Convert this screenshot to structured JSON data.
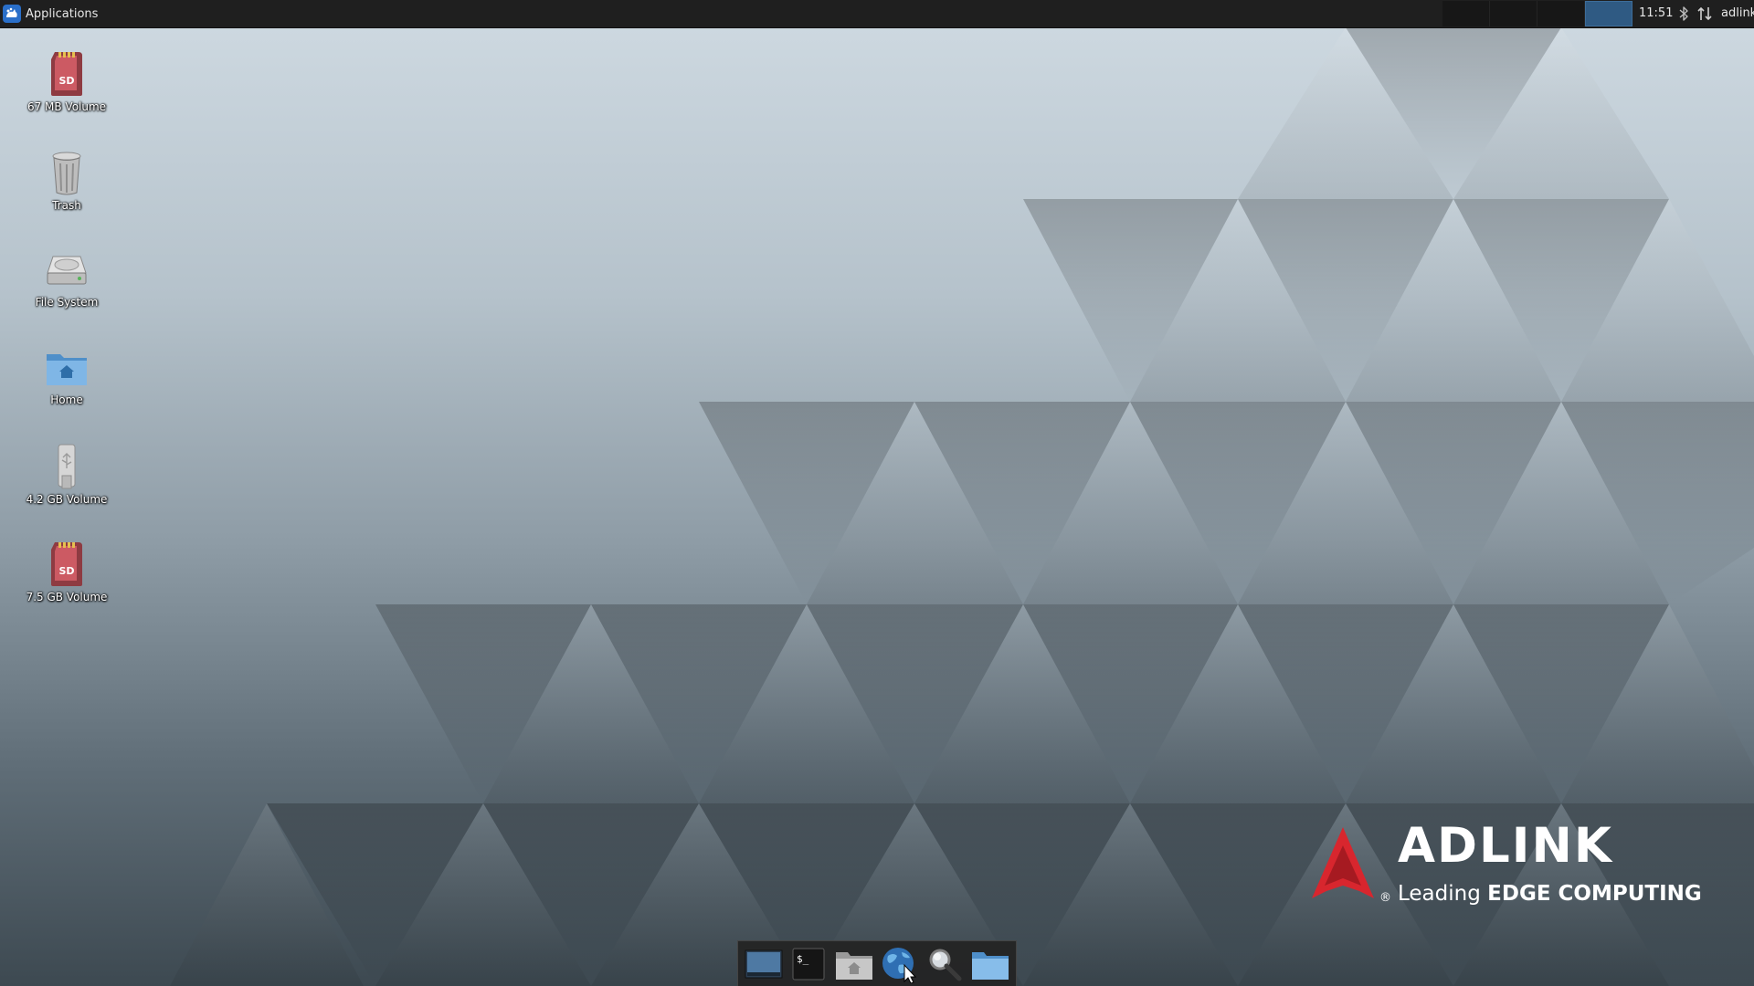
{
  "panel": {
    "apps_menu_label": "Applications",
    "apps_menu_icon": "xfce-mouse-logo-icon",
    "workspaces": [
      {
        "name": "workspace-1",
        "active": false
      },
      {
        "name": "workspace-2",
        "active": false
      },
      {
        "name": "workspace-3",
        "active": false
      },
      {
        "name": "workspace-4",
        "active": true
      }
    ],
    "clock": "11:51",
    "tray_icons": [
      "bluetooth-icon",
      "network-icon"
    ],
    "user": "adlink"
  },
  "desktop_icons": [
    {
      "label": "67 MB Volume",
      "icon": "sd-card-icon"
    },
    {
      "label": "Trash",
      "icon": "trash-icon"
    },
    {
      "label": "File System",
      "icon": "hard-drive-icon"
    },
    {
      "label": "Home",
      "icon": "home-folder-icon"
    },
    {
      "label": "4.2 GB Volume",
      "icon": "usb-drive-icon"
    },
    {
      "label": "7.5 GB Volume",
      "icon": "sd-card-icon"
    }
  ],
  "wallpaper": {
    "brand": "ADLINK",
    "tagline_regular": "Leading ",
    "tagline_bold": "EDGE COMPUTING",
    "registered_mark": "®",
    "brand_color": "#d8262e"
  },
  "dock": {
    "items": [
      {
        "name": "show-desktop",
        "icon": "show-desktop-icon"
      },
      {
        "name": "terminal",
        "icon": "terminal-icon"
      },
      {
        "name": "file-manager",
        "icon": "home-folder-icon"
      },
      {
        "name": "web-browser",
        "icon": "globe-icon"
      },
      {
        "name": "app-finder",
        "icon": "magnifier-icon"
      },
      {
        "name": "files",
        "icon": "folder-icon"
      }
    ],
    "terminal_prompt": "$_"
  },
  "accent_color": "#2f5a83"
}
